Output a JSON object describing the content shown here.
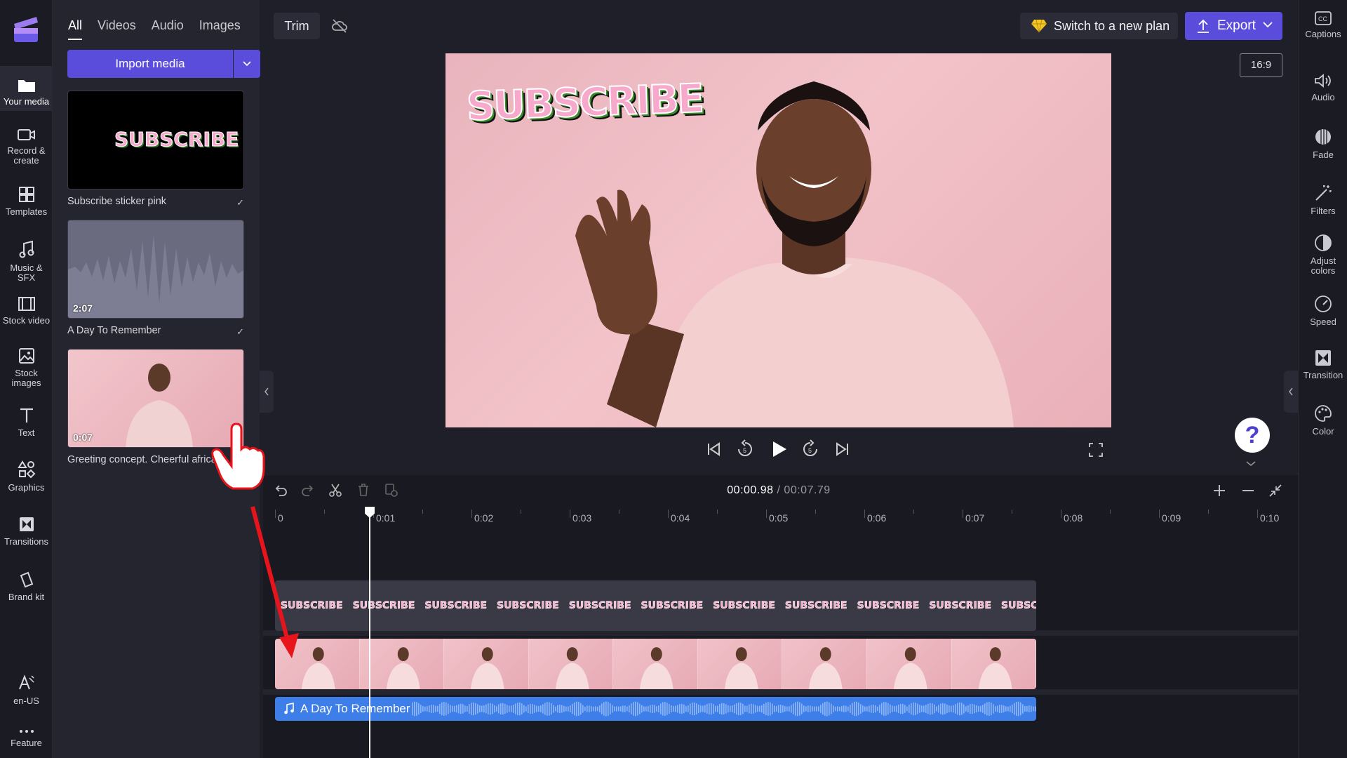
{
  "app": {
    "name": "Clipchamp"
  },
  "left_nav": [
    {
      "label": "Your media",
      "icon": "folder-icon"
    },
    {
      "label": "Record & create",
      "icon": "camera-icon"
    },
    {
      "label": "Templates",
      "icon": "templates-icon"
    },
    {
      "label": "Music & SFX",
      "icon": "music-icon"
    },
    {
      "label": "Stock video",
      "icon": "film-icon"
    },
    {
      "label": "Stock images",
      "icon": "image-icon"
    },
    {
      "label": "Text",
      "icon": "text-icon"
    },
    {
      "label": "Graphics",
      "icon": "shapes-icon"
    },
    {
      "label": "Transitions",
      "icon": "transitions-icon"
    },
    {
      "label": "Brand kit",
      "icon": "brand-kit-icon"
    },
    {
      "label": "en-US",
      "icon": "language-icon"
    },
    {
      "label": "Feature",
      "icon": "more-icon"
    }
  ],
  "media_panel": {
    "tabs": [
      "All",
      "Videos",
      "Audio",
      "Images"
    ],
    "active_tab": "All",
    "import_label": "Import media",
    "items": [
      {
        "title": "Subscribe sticker pink",
        "thumb_text": "SUBSCRIBE",
        "duration": ""
      },
      {
        "title": "A Day To Remember",
        "duration": "2:07"
      },
      {
        "title": "Greeting concept. Cheerful african",
        "duration": "0:07"
      }
    ]
  },
  "topbar": {
    "trim_label": "Trim",
    "plan_label": "Switch to a new plan",
    "export_label": "Export",
    "aspect_ratio": "16:9"
  },
  "preview": {
    "sticker_text": "SUBSCRIBE"
  },
  "right_rail": [
    {
      "label": "Captions",
      "icon": "captions-icon"
    },
    {
      "label": "Audio",
      "icon": "speaker-icon"
    },
    {
      "label": "Fade",
      "icon": "fade-icon"
    },
    {
      "label": "Filters",
      "icon": "magic-wand-icon"
    },
    {
      "label": "Adjust colors",
      "icon": "contrast-icon"
    },
    {
      "label": "Speed",
      "icon": "speedometer-icon"
    },
    {
      "label": "Transition",
      "icon": "transition-icon"
    },
    {
      "label": "Color",
      "icon": "palette-icon"
    }
  ],
  "timeline": {
    "current_time": "00:00.98",
    "separator": "/",
    "total_time": "00:07.79",
    "ruler_labels": [
      "0",
      "0:01",
      "0:02",
      "0:03",
      "0:04",
      "0:05",
      "0:06",
      "0:07",
      "0:08",
      "0:09",
      "0:10"
    ],
    "sticker_track_text": "SUBSCRIBE",
    "audio_track_label": "A Day To Remember",
    "playhead_seconds": 0.98
  },
  "help": {
    "label": "?"
  },
  "colors": {
    "accent": "#5b4ddb",
    "audio_track": "#3e7ee8",
    "annotation_arrow": "#e8141c"
  }
}
